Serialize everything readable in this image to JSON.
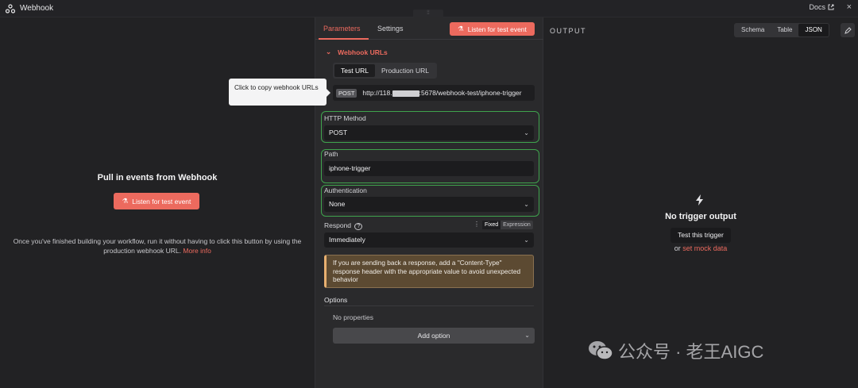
{
  "window": {
    "title": "Webhook",
    "docs_label": "Docs",
    "close_glyph": "×"
  },
  "left": {
    "heading": "Pull in events from Webhook",
    "listen_label": "Listen for test event",
    "description": "Once you've finished building your workflow, run it without having to click this button by using the production webhook URL.",
    "more_info": "More info"
  },
  "params": {
    "tabs": [
      "Parameters",
      "Settings"
    ],
    "listen_label": "Listen for test event",
    "webhook_urls_title": "Webhook URLs",
    "url_tabs": [
      "Test URL",
      "Production URL"
    ],
    "method_badge": "POST",
    "url_prefix": "http://118.",
    "url_suffix": ":5678/webhook-test/iphone-trigger",
    "tooltip": "Click to copy webhook URLs",
    "http_method": {
      "label": "HTTP Method",
      "value": "POST"
    },
    "path": {
      "label": "Path",
      "value": "iphone-trigger"
    },
    "authentication": {
      "label": "Authentication",
      "value": "None"
    },
    "respond": {
      "label": "Respond",
      "value": "Immediately",
      "modes": [
        "Fixed",
        "Expression"
      ]
    },
    "warning": "If you are sending back a response, add a \"Content-Type\" response header with the appropriate value to avoid unexpected behavior",
    "options_title": "Options",
    "no_properties": "No properties",
    "add_option": "Add option"
  },
  "output": {
    "title": "OUTPUT",
    "views": [
      "Schema",
      "Table",
      "JSON"
    ],
    "active_view": "JSON",
    "empty_title": "No trigger output",
    "test_trigger": "Test this trigger",
    "or_text": "or",
    "mock_link": "set mock data"
  },
  "watermark": "公众号 · 老王AIGC",
  "colors": {
    "accent": "#ec6a5e",
    "highlight": "#3fa34d",
    "warning_bg": "#5c4a32"
  }
}
